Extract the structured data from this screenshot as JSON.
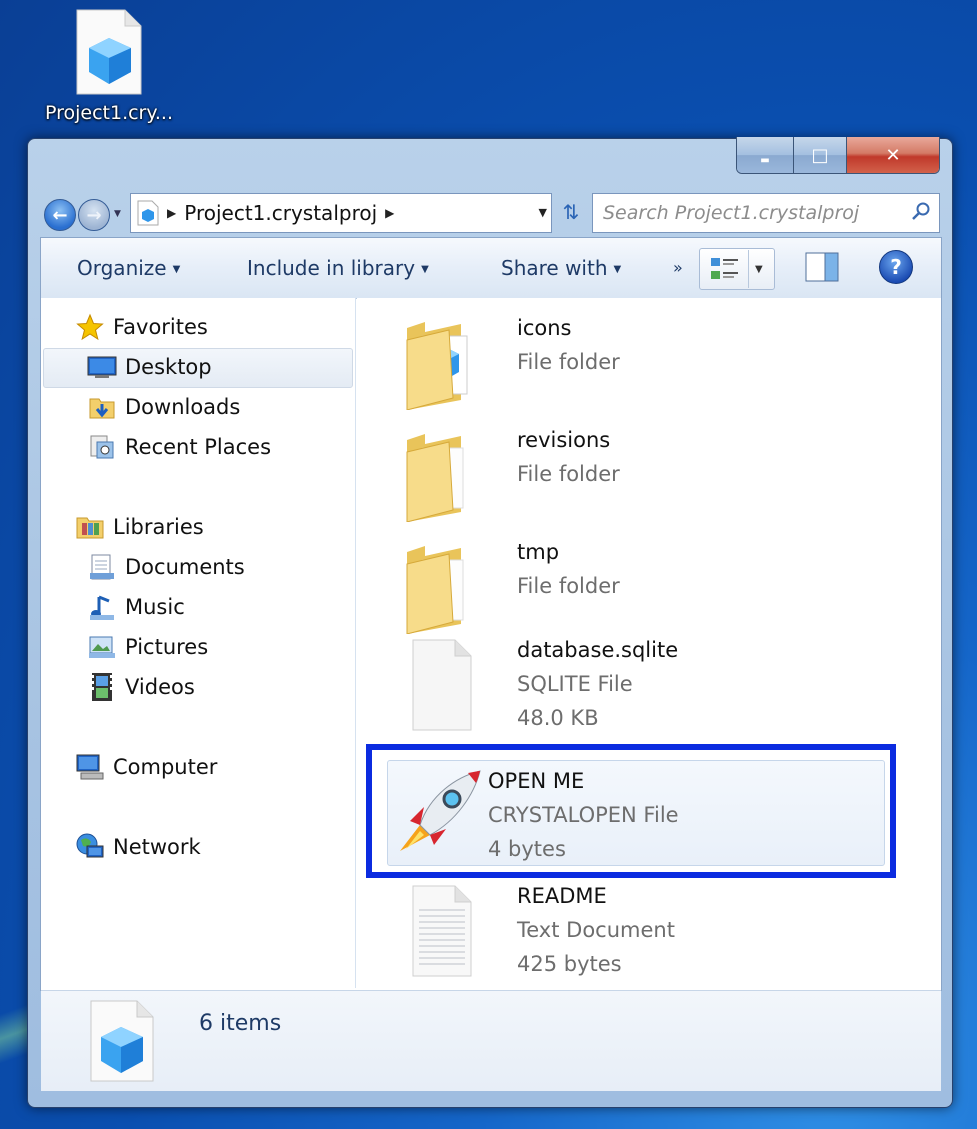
{
  "desktop": {
    "icon_label": "Project1.cry..."
  },
  "window": {
    "caption": {
      "minimize": "▬",
      "maximize": "□",
      "close": "✕"
    },
    "address": {
      "crumb": "Project1.crystalproj"
    },
    "search": {
      "placeholder": "Search Project1.crystalproj"
    },
    "toolbar": {
      "organize": "Organize",
      "include": "Include in library",
      "share": "Share with",
      "more": "»"
    },
    "nav": {
      "favorites": "Favorites",
      "desktop": "Desktop",
      "downloads": "Downloads",
      "recent": "Recent Places",
      "libraries": "Libraries",
      "documents": "Documents",
      "music": "Music",
      "pictures": "Pictures",
      "videos": "Videos",
      "computer": "Computer",
      "network": "Network"
    },
    "files": [
      {
        "name": "icons",
        "type": "File folder",
        "size": ""
      },
      {
        "name": "revisions",
        "type": "File folder",
        "size": ""
      },
      {
        "name": "tmp",
        "type": "File folder",
        "size": ""
      },
      {
        "name": "database.sqlite",
        "type": "SQLITE File",
        "size": "48.0 KB"
      },
      {
        "name": "OPEN ME",
        "type": "CRYSTALOPEN File",
        "size": "4 bytes"
      },
      {
        "name": "README",
        "type": "Text Document",
        "size": "425 bytes"
      }
    ],
    "status": {
      "count": "6 items"
    }
  },
  "colors": {
    "accent": "#0b2be0",
    "toolbar_text": "#1e3a66"
  }
}
